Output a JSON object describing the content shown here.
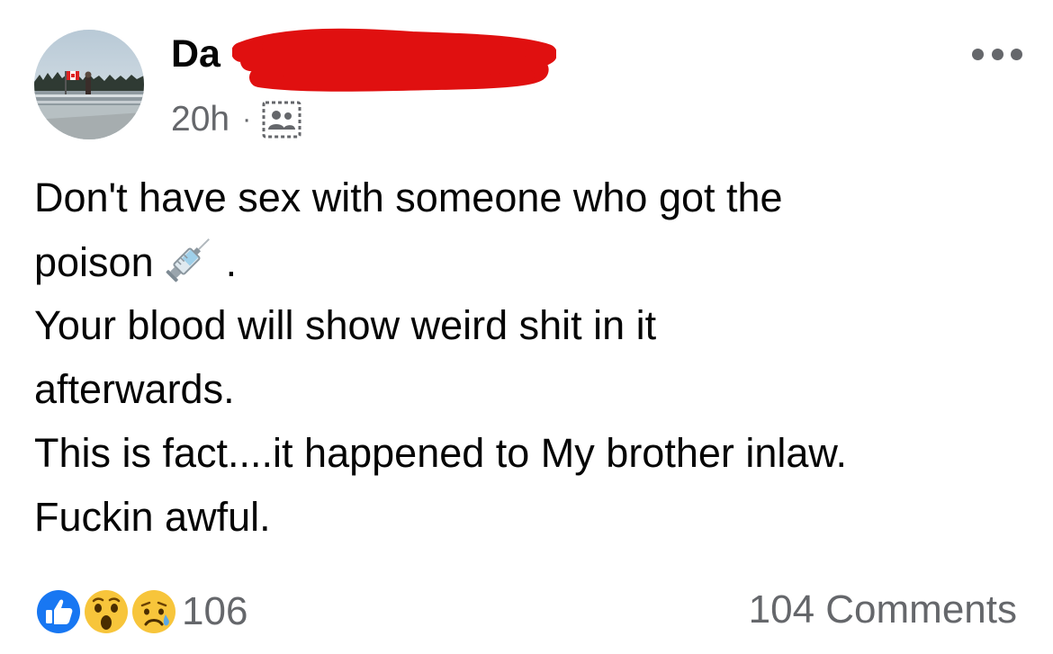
{
  "post": {
    "author_visible": "Da",
    "time": "20h",
    "separator": "·",
    "audience_icon": "friends-audience-icon",
    "more_icon": "more-options-icon",
    "lines": [
      "Don't have sex with someone who got the",
      "poison",
      "Your blood will show weird shit in it",
      "afterwards.",
      "This is fact....it happened to My brother inlaw.",
      "Fuckin awful."
    ],
    "poison_suffix": ".",
    "inline_emoji": "syringe-emoji"
  },
  "reactions": {
    "icons": [
      "like-reaction-icon",
      "wow-reaction-icon",
      "sad-reaction-icon"
    ],
    "count": "106"
  },
  "comments": {
    "label": "104 Comments"
  },
  "colors": {
    "text_primary": "#050505",
    "text_secondary": "#65676b",
    "like_blue": "#1877f2",
    "redaction_red": "#e01010"
  }
}
